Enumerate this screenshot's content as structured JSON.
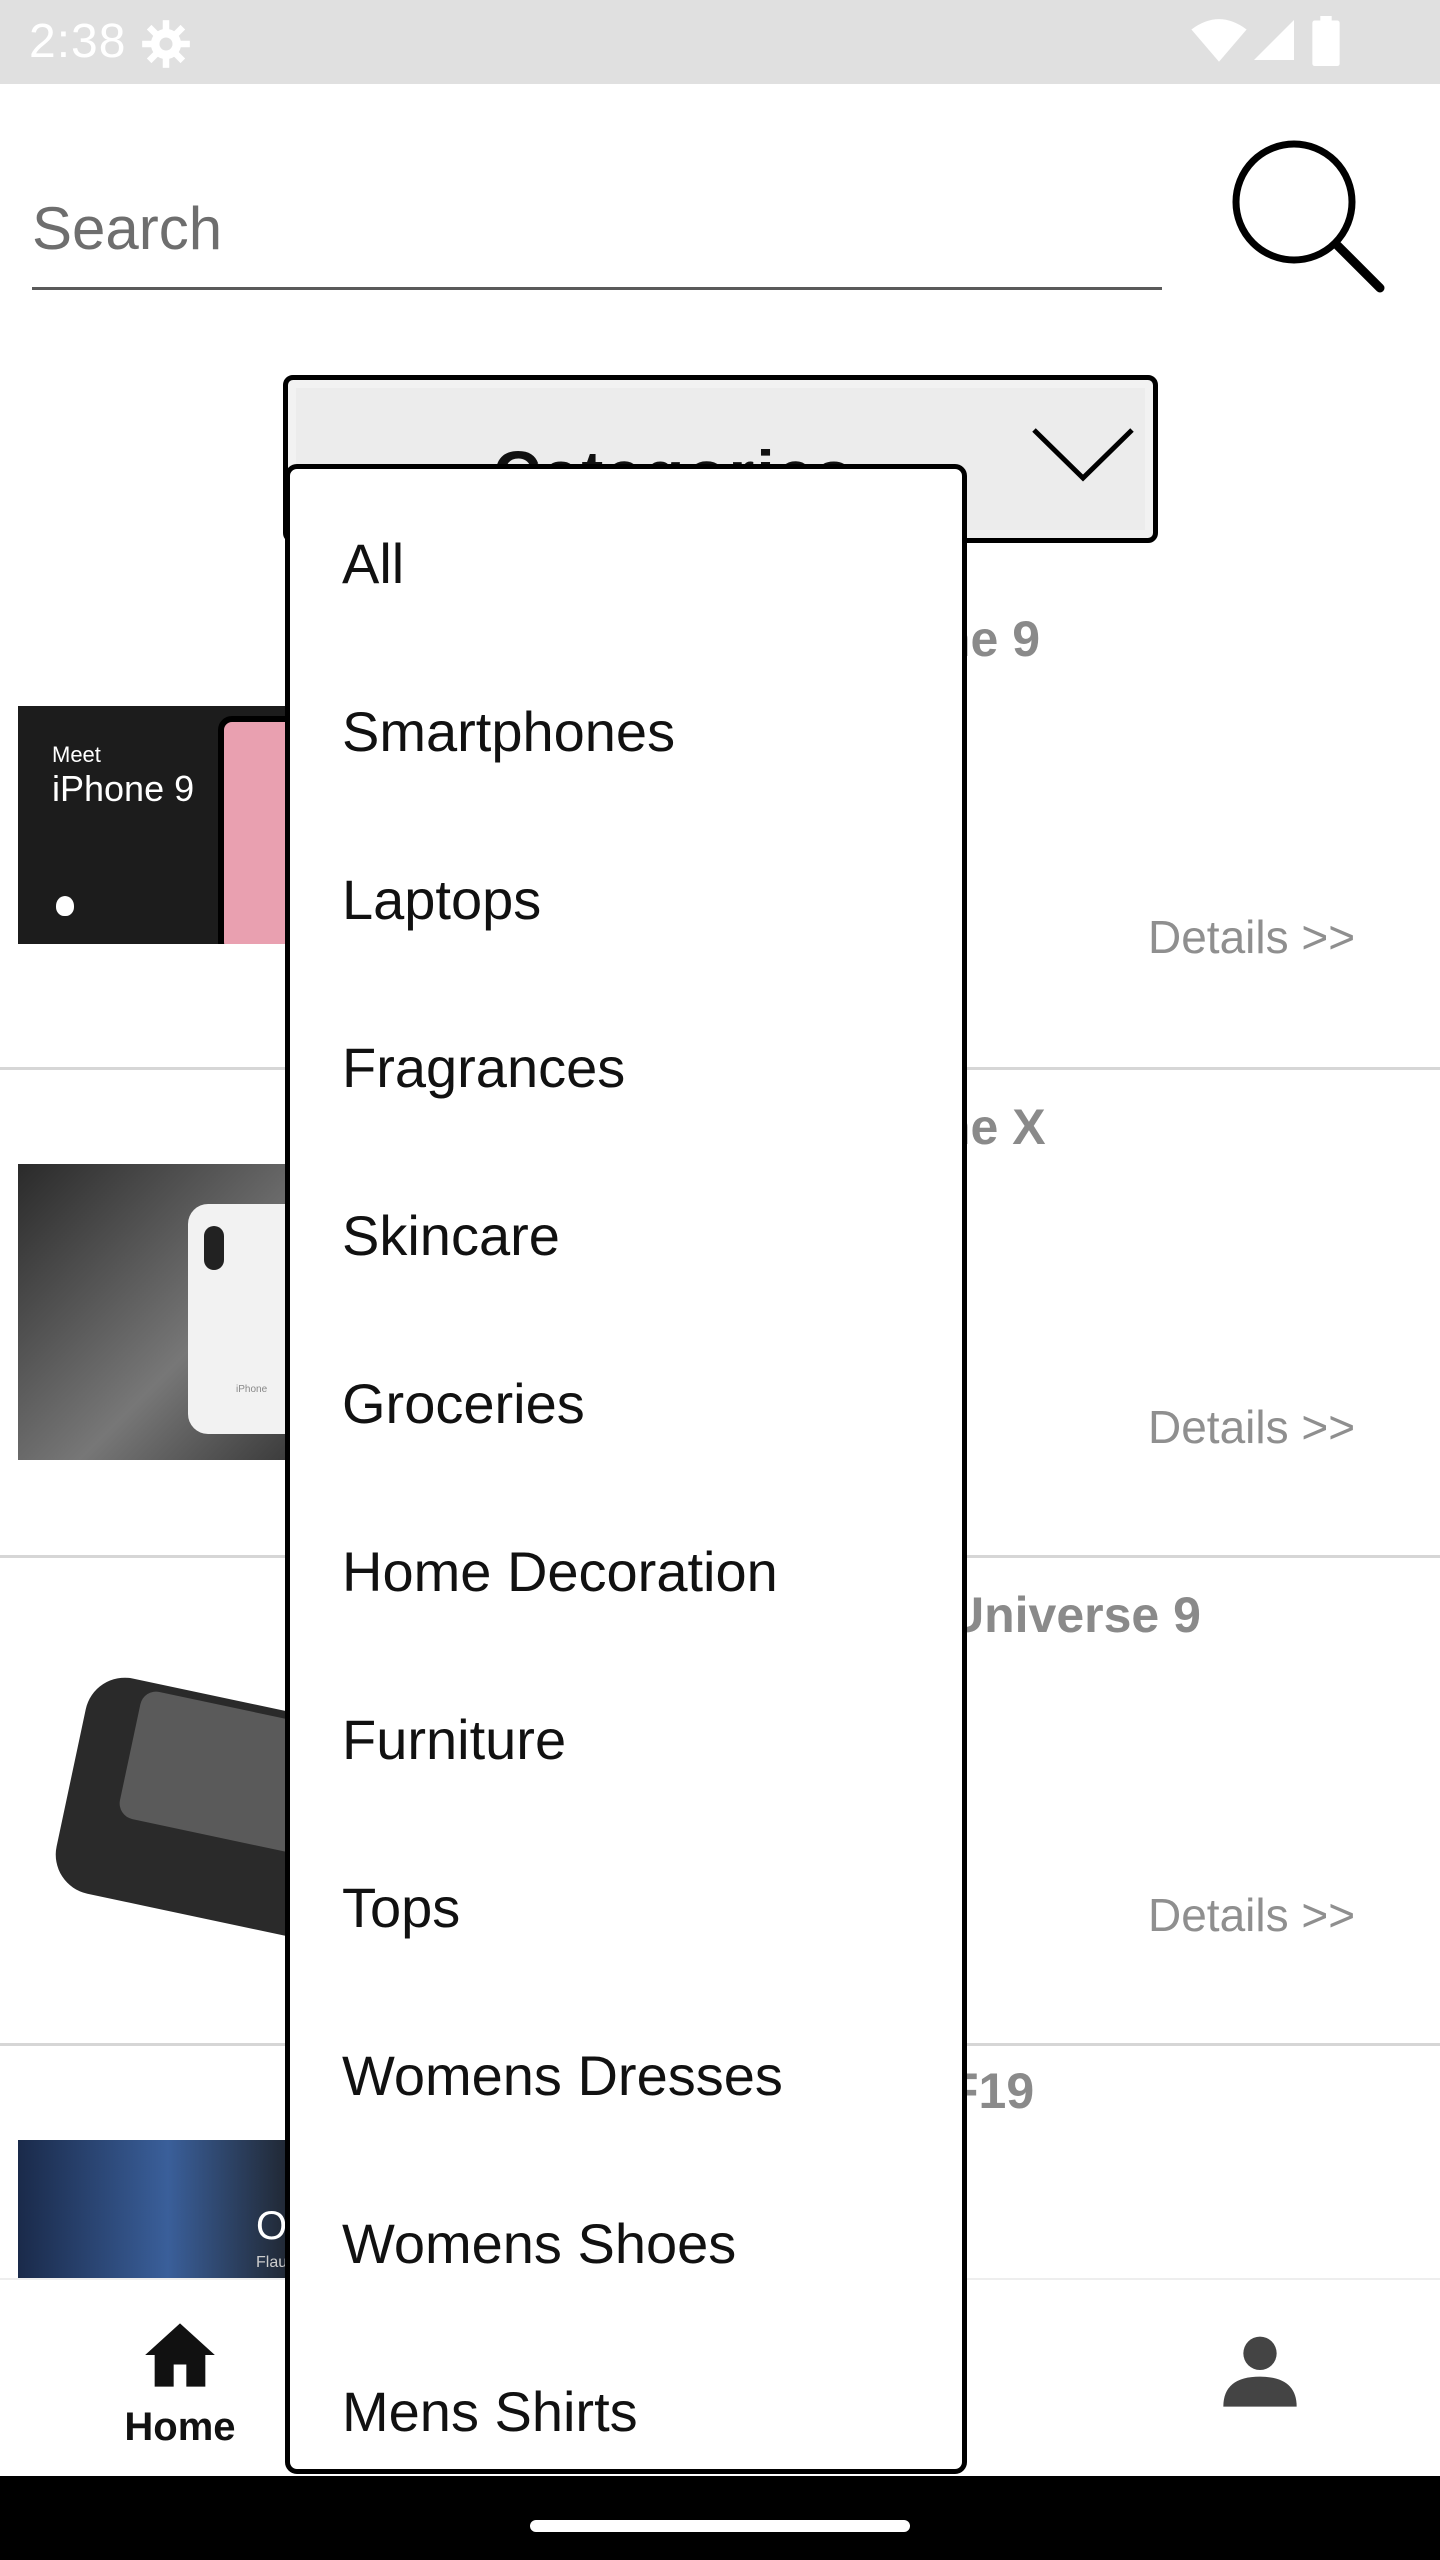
{
  "status_bar": {
    "time": "2:38",
    "icons": [
      "gear-icon",
      "wifi-icon",
      "signal-icon",
      "battery-icon"
    ]
  },
  "search": {
    "placeholder": "Search"
  },
  "categories": {
    "label": "Categories"
  },
  "products": [
    {
      "title": "iPhone 9",
      "title_visible": "ne 9",
      "details": "Details >>",
      "thumb": {
        "small_text": "Meet",
        "big_text": "iPhone 9"
      }
    },
    {
      "title_visible": "ne X",
      "details": "Details >>",
      "thumb": {
        "small_text": "iPhone"
      }
    },
    {
      "title_visible": "Universe 9",
      "details": "Details >>"
    },
    {
      "title_visible": "F19",
      "thumb": {
        "text": "O",
        "small_text": "Flau"
      }
    }
  ],
  "dropdown": {
    "items": [
      "All",
      "Smartphones",
      "Laptops",
      "Fragrances",
      "Skincare",
      "Groceries",
      "Home Decoration",
      "Furniture",
      "Tops",
      "Womens Dresses",
      "Womens Shoes",
      "Mens Shirts"
    ]
  },
  "bottom_nav": {
    "home_label": "Home"
  },
  "colors": {
    "text_secondary": "#8a8a8a",
    "status_bar": "#e0e0e0",
    "divider": "#d6d6d6"
  }
}
